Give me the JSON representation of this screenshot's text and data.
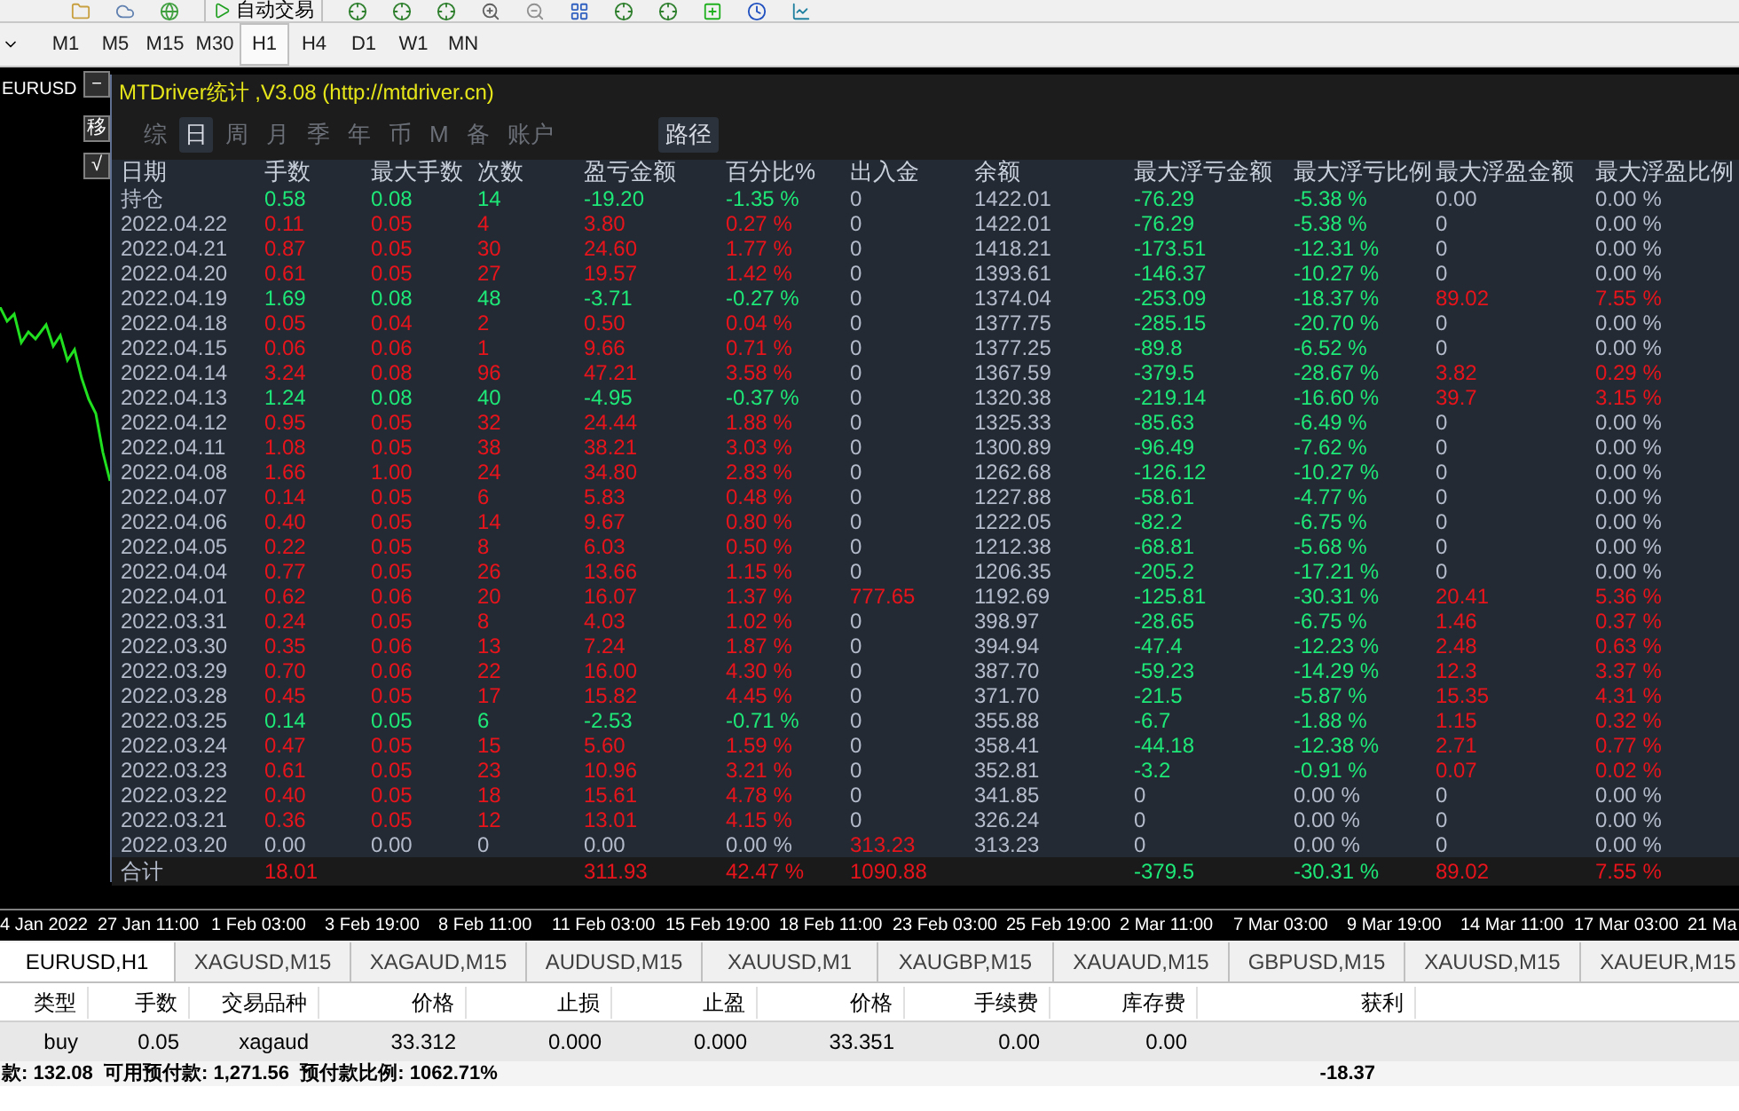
{
  "toolbar": {
    "auto_trading_label": "自动交易"
  },
  "timeframes": [
    {
      "label": "M1",
      "selected": false
    },
    {
      "label": "M5",
      "selected": false
    },
    {
      "label": "M15",
      "selected": false
    },
    {
      "label": "M30",
      "selected": false
    },
    {
      "label": "H1",
      "selected": true
    },
    {
      "label": "H4",
      "selected": false
    },
    {
      "label": "D1",
      "selected": false
    },
    {
      "label": "W1",
      "selected": false
    },
    {
      "label": "MN",
      "selected": false
    }
  ],
  "chart": {
    "symbol_label": "EURUSD",
    "side_buttons": [
      "－",
      "移",
      "√"
    ],
    "time_axis": [
      "4 Jan 2022",
      "27 Jan 11:00",
      "1 Feb 03:00",
      "3 Feb 19:00",
      "8 Feb 11:00",
      "11 Feb 03:00",
      "15 Feb 19:00",
      "18 Feb 11:00",
      "23 Feb 03:00",
      "25 Feb 19:00",
      "2 Mar 11:00",
      "7 Mar 03:00",
      "9 Mar 19:00",
      "14 Mar 11:00",
      "17 Mar 03:00",
      "21 Ma"
    ]
  },
  "stats_panel": {
    "title": "MTDriver统计 ,V3.08 (http://mtdriver.cn)",
    "tabs": [
      {
        "label": "综",
        "selected": false
      },
      {
        "label": "日",
        "selected": true
      },
      {
        "label": "周",
        "selected": false
      },
      {
        "label": "月",
        "selected": false
      },
      {
        "label": "季",
        "selected": false
      },
      {
        "label": "年",
        "selected": false
      },
      {
        "label": "币",
        "selected": false
      },
      {
        "label": "M",
        "selected": false
      },
      {
        "label": "备",
        "selected": false
      },
      {
        "label": "账户",
        "selected": false
      }
    ],
    "path_button": "路径",
    "columns": [
      "日期",
      "手数",
      "最大手数",
      "次数",
      "盈亏金额",
      "百分比%",
      "出入金",
      "余额",
      "最大浮亏金额",
      "最大浮亏比例",
      "最大浮盈金额",
      "最大浮盈比例"
    ],
    "rows": [
      [
        {
          "text": "持仓",
          "color": "#b4bccc"
        },
        {
          "text": "0.58",
          "color": "#1ee878"
        },
        {
          "text": "0.08",
          "color": "#1ee878"
        },
        {
          "text": "14",
          "color": "#1ee878"
        },
        {
          "text": "-19.20",
          "color": "#1ee878"
        },
        {
          "text": "-1.35 %",
          "color": "#1ee878"
        },
        {
          "text": "0",
          "color": "#b4bccc"
        },
        {
          "text": "1422.01",
          "color": "#b4bccc"
        },
        {
          "text": "-76.29",
          "color": "#1ee878"
        },
        {
          "text": "-5.38 %",
          "color": "#1ee878"
        },
        {
          "text": "0.00",
          "color": "#b4bccc"
        },
        {
          "text": "0.00 %",
          "color": "#b4bccc"
        }
      ],
      [
        {
          "text": "2022.04.22",
          "color": "#b4bccc"
        },
        {
          "text": "0.11",
          "color": "#e8141c"
        },
        {
          "text": "0.05",
          "color": "#e8141c"
        },
        {
          "text": "4",
          "color": "#e8141c"
        },
        {
          "text": "3.80",
          "color": "#e8141c"
        },
        {
          "text": "0.27 %",
          "color": "#e8141c"
        },
        {
          "text": "0",
          "color": "#b4bccc"
        },
        {
          "text": "1422.01",
          "color": "#b4bccc"
        },
        {
          "text": "-76.29",
          "color": "#1ee878"
        },
        {
          "text": "-5.38 %",
          "color": "#1ee878"
        },
        {
          "text": "0",
          "color": "#b4bccc"
        },
        {
          "text": "0.00 %",
          "color": "#b4bccc"
        }
      ],
      [
        {
          "text": "2022.04.21",
          "color": "#b4bccc"
        },
        {
          "text": "0.87",
          "color": "#e8141c"
        },
        {
          "text": "0.05",
          "color": "#e8141c"
        },
        {
          "text": "30",
          "color": "#e8141c"
        },
        {
          "text": "24.60",
          "color": "#e8141c"
        },
        {
          "text": "1.77 %",
          "color": "#e8141c"
        },
        {
          "text": "0",
          "color": "#b4bccc"
        },
        {
          "text": "1418.21",
          "color": "#b4bccc"
        },
        {
          "text": "-173.51",
          "color": "#1ee878"
        },
        {
          "text": "-12.31 %",
          "color": "#1ee878"
        },
        {
          "text": "0",
          "color": "#b4bccc"
        },
        {
          "text": "0.00 %",
          "color": "#b4bccc"
        }
      ],
      [
        {
          "text": "2022.04.20",
          "color": "#b4bccc"
        },
        {
          "text": "0.61",
          "color": "#e8141c"
        },
        {
          "text": "0.05",
          "color": "#e8141c"
        },
        {
          "text": "27",
          "color": "#e8141c"
        },
        {
          "text": "19.57",
          "color": "#e8141c"
        },
        {
          "text": "1.42 %",
          "color": "#e8141c"
        },
        {
          "text": "0",
          "color": "#b4bccc"
        },
        {
          "text": "1393.61",
          "color": "#b4bccc"
        },
        {
          "text": "-146.37",
          "color": "#1ee878"
        },
        {
          "text": "-10.27 %",
          "color": "#1ee878"
        },
        {
          "text": "0",
          "color": "#b4bccc"
        },
        {
          "text": "0.00 %",
          "color": "#b4bccc"
        }
      ],
      [
        {
          "text": "2022.04.19",
          "color": "#b4bccc"
        },
        {
          "text": "1.69",
          "color": "#1ee878"
        },
        {
          "text": "0.08",
          "color": "#1ee878"
        },
        {
          "text": "48",
          "color": "#1ee878"
        },
        {
          "text": "-3.71",
          "color": "#1ee878"
        },
        {
          "text": "-0.27 %",
          "color": "#1ee878"
        },
        {
          "text": "0",
          "color": "#b4bccc"
        },
        {
          "text": "1374.04",
          "color": "#b4bccc"
        },
        {
          "text": "-253.09",
          "color": "#1ee878"
        },
        {
          "text": "-18.37 %",
          "color": "#1ee878"
        },
        {
          "text": "89.02",
          "color": "#e8141c"
        },
        {
          "text": "7.55 %",
          "color": "#e8141c"
        }
      ],
      [
        {
          "text": "2022.04.18",
          "color": "#b4bccc"
        },
        {
          "text": "0.05",
          "color": "#e8141c"
        },
        {
          "text": "0.04",
          "color": "#e8141c"
        },
        {
          "text": "2",
          "color": "#e8141c"
        },
        {
          "text": "0.50",
          "color": "#e8141c"
        },
        {
          "text": "0.04 %",
          "color": "#e8141c"
        },
        {
          "text": "0",
          "color": "#b4bccc"
        },
        {
          "text": "1377.75",
          "color": "#b4bccc"
        },
        {
          "text": "-285.15",
          "color": "#1ee878"
        },
        {
          "text": "-20.70 %",
          "color": "#1ee878"
        },
        {
          "text": "0",
          "color": "#b4bccc"
        },
        {
          "text": "0.00 %",
          "color": "#b4bccc"
        }
      ],
      [
        {
          "text": "2022.04.15",
          "color": "#b4bccc"
        },
        {
          "text": "0.06",
          "color": "#e8141c"
        },
        {
          "text": "0.06",
          "color": "#e8141c"
        },
        {
          "text": "1",
          "color": "#e8141c"
        },
        {
          "text": "9.66",
          "color": "#e8141c"
        },
        {
          "text": "0.71 %",
          "color": "#e8141c"
        },
        {
          "text": "0",
          "color": "#b4bccc"
        },
        {
          "text": "1377.25",
          "color": "#b4bccc"
        },
        {
          "text": "-89.8",
          "color": "#1ee878"
        },
        {
          "text": "-6.52 %",
          "color": "#1ee878"
        },
        {
          "text": "0",
          "color": "#b4bccc"
        },
        {
          "text": "0.00 %",
          "color": "#b4bccc"
        }
      ],
      [
        {
          "text": "2022.04.14",
          "color": "#b4bccc"
        },
        {
          "text": "3.24",
          "color": "#e8141c"
        },
        {
          "text": "0.08",
          "color": "#e8141c"
        },
        {
          "text": "96",
          "color": "#e8141c"
        },
        {
          "text": "47.21",
          "color": "#e8141c"
        },
        {
          "text": "3.58 %",
          "color": "#e8141c"
        },
        {
          "text": "0",
          "color": "#b4bccc"
        },
        {
          "text": "1367.59",
          "color": "#b4bccc"
        },
        {
          "text": "-379.5",
          "color": "#1ee878"
        },
        {
          "text": "-28.67 %",
          "color": "#1ee878"
        },
        {
          "text": "3.82",
          "color": "#e8141c"
        },
        {
          "text": "0.29 %",
          "color": "#e8141c"
        }
      ],
      [
        {
          "text": "2022.04.13",
          "color": "#b4bccc"
        },
        {
          "text": "1.24",
          "color": "#1ee878"
        },
        {
          "text": "0.08",
          "color": "#1ee878"
        },
        {
          "text": "40",
          "color": "#1ee878"
        },
        {
          "text": "-4.95",
          "color": "#1ee878"
        },
        {
          "text": "-0.37 %",
          "color": "#1ee878"
        },
        {
          "text": "0",
          "color": "#b4bccc"
        },
        {
          "text": "1320.38",
          "color": "#b4bccc"
        },
        {
          "text": "-219.14",
          "color": "#1ee878"
        },
        {
          "text": "-16.60 %",
          "color": "#1ee878"
        },
        {
          "text": "39.7",
          "color": "#e8141c"
        },
        {
          "text": "3.15 %",
          "color": "#e8141c"
        }
      ],
      [
        {
          "text": "2022.04.12",
          "color": "#b4bccc"
        },
        {
          "text": "0.95",
          "color": "#e8141c"
        },
        {
          "text": "0.05",
          "color": "#e8141c"
        },
        {
          "text": "32",
          "color": "#e8141c"
        },
        {
          "text": "24.44",
          "color": "#e8141c"
        },
        {
          "text": "1.88 %",
          "color": "#e8141c"
        },
        {
          "text": "0",
          "color": "#b4bccc"
        },
        {
          "text": "1325.33",
          "color": "#b4bccc"
        },
        {
          "text": "-85.63",
          "color": "#1ee878"
        },
        {
          "text": "-6.49 %",
          "color": "#1ee878"
        },
        {
          "text": "0",
          "color": "#b4bccc"
        },
        {
          "text": "0.00 %",
          "color": "#b4bccc"
        }
      ],
      [
        {
          "text": "2022.04.11",
          "color": "#b4bccc"
        },
        {
          "text": "1.08",
          "color": "#e8141c"
        },
        {
          "text": "0.05",
          "color": "#e8141c"
        },
        {
          "text": "38",
          "color": "#e8141c"
        },
        {
          "text": "38.21",
          "color": "#e8141c"
        },
        {
          "text": "3.03 %",
          "color": "#e8141c"
        },
        {
          "text": "0",
          "color": "#b4bccc"
        },
        {
          "text": "1300.89",
          "color": "#b4bccc"
        },
        {
          "text": "-96.49",
          "color": "#1ee878"
        },
        {
          "text": "-7.62 %",
          "color": "#1ee878"
        },
        {
          "text": "0",
          "color": "#b4bccc"
        },
        {
          "text": "0.00 %",
          "color": "#b4bccc"
        }
      ],
      [
        {
          "text": "2022.04.08",
          "color": "#b4bccc"
        },
        {
          "text": "1.66",
          "color": "#e8141c"
        },
        {
          "text": "1.00",
          "color": "#e8141c"
        },
        {
          "text": "24",
          "color": "#e8141c"
        },
        {
          "text": "34.80",
          "color": "#e8141c"
        },
        {
          "text": "2.83 %",
          "color": "#e8141c"
        },
        {
          "text": "0",
          "color": "#b4bccc"
        },
        {
          "text": "1262.68",
          "color": "#b4bccc"
        },
        {
          "text": "-126.12",
          "color": "#1ee878"
        },
        {
          "text": "-10.27 %",
          "color": "#1ee878"
        },
        {
          "text": "0",
          "color": "#b4bccc"
        },
        {
          "text": "0.00 %",
          "color": "#b4bccc"
        }
      ],
      [
        {
          "text": "2022.04.07",
          "color": "#b4bccc"
        },
        {
          "text": "0.14",
          "color": "#e8141c"
        },
        {
          "text": "0.05",
          "color": "#e8141c"
        },
        {
          "text": "6",
          "color": "#e8141c"
        },
        {
          "text": "5.83",
          "color": "#e8141c"
        },
        {
          "text": "0.48 %",
          "color": "#e8141c"
        },
        {
          "text": "0",
          "color": "#b4bccc"
        },
        {
          "text": "1227.88",
          "color": "#b4bccc"
        },
        {
          "text": "-58.61",
          "color": "#1ee878"
        },
        {
          "text": "-4.77 %",
          "color": "#1ee878"
        },
        {
          "text": "0",
          "color": "#b4bccc"
        },
        {
          "text": "0.00 %",
          "color": "#b4bccc"
        }
      ],
      [
        {
          "text": "2022.04.06",
          "color": "#b4bccc"
        },
        {
          "text": "0.40",
          "color": "#e8141c"
        },
        {
          "text": "0.05",
          "color": "#e8141c"
        },
        {
          "text": "14",
          "color": "#e8141c"
        },
        {
          "text": "9.67",
          "color": "#e8141c"
        },
        {
          "text": "0.80 %",
          "color": "#e8141c"
        },
        {
          "text": "0",
          "color": "#b4bccc"
        },
        {
          "text": "1222.05",
          "color": "#b4bccc"
        },
        {
          "text": "-82.2",
          "color": "#1ee878"
        },
        {
          "text": "-6.75 %",
          "color": "#1ee878"
        },
        {
          "text": "0",
          "color": "#b4bccc"
        },
        {
          "text": "0.00 %",
          "color": "#b4bccc"
        }
      ],
      [
        {
          "text": "2022.04.05",
          "color": "#b4bccc"
        },
        {
          "text": "0.22",
          "color": "#e8141c"
        },
        {
          "text": "0.05",
          "color": "#e8141c"
        },
        {
          "text": "8",
          "color": "#e8141c"
        },
        {
          "text": "6.03",
          "color": "#e8141c"
        },
        {
          "text": "0.50 %",
          "color": "#e8141c"
        },
        {
          "text": "0",
          "color": "#b4bccc"
        },
        {
          "text": "1212.38",
          "color": "#b4bccc"
        },
        {
          "text": "-68.81",
          "color": "#1ee878"
        },
        {
          "text": "-5.68 %",
          "color": "#1ee878"
        },
        {
          "text": "0",
          "color": "#b4bccc"
        },
        {
          "text": "0.00 %",
          "color": "#b4bccc"
        }
      ],
      [
        {
          "text": "2022.04.04",
          "color": "#b4bccc"
        },
        {
          "text": "0.77",
          "color": "#e8141c"
        },
        {
          "text": "0.05",
          "color": "#e8141c"
        },
        {
          "text": "26",
          "color": "#e8141c"
        },
        {
          "text": "13.66",
          "color": "#e8141c"
        },
        {
          "text": "1.15 %",
          "color": "#e8141c"
        },
        {
          "text": "0",
          "color": "#b4bccc"
        },
        {
          "text": "1206.35",
          "color": "#b4bccc"
        },
        {
          "text": "-205.2",
          "color": "#1ee878"
        },
        {
          "text": "-17.21 %",
          "color": "#1ee878"
        },
        {
          "text": "0",
          "color": "#b4bccc"
        },
        {
          "text": "0.00 %",
          "color": "#b4bccc"
        }
      ],
      [
        {
          "text": "2022.04.01",
          "color": "#b4bccc"
        },
        {
          "text": "0.62",
          "color": "#e8141c"
        },
        {
          "text": "0.06",
          "color": "#e8141c"
        },
        {
          "text": "20",
          "color": "#e8141c"
        },
        {
          "text": "16.07",
          "color": "#e8141c"
        },
        {
          "text": "1.37 %",
          "color": "#e8141c"
        },
        {
          "text": "777.65",
          "color": "#e8141c"
        },
        {
          "text": "1192.69",
          "color": "#b4bccc"
        },
        {
          "text": "-125.81",
          "color": "#1ee878"
        },
        {
          "text": "-30.31 %",
          "color": "#1ee878"
        },
        {
          "text": "20.41",
          "color": "#e8141c"
        },
        {
          "text": "5.36 %",
          "color": "#e8141c"
        }
      ],
      [
        {
          "text": "2022.03.31",
          "color": "#b4bccc"
        },
        {
          "text": "0.24",
          "color": "#e8141c"
        },
        {
          "text": "0.05",
          "color": "#e8141c"
        },
        {
          "text": "8",
          "color": "#e8141c"
        },
        {
          "text": "4.03",
          "color": "#e8141c"
        },
        {
          "text": "1.02 %",
          "color": "#e8141c"
        },
        {
          "text": "0",
          "color": "#b4bccc"
        },
        {
          "text": "398.97",
          "color": "#b4bccc"
        },
        {
          "text": "-28.65",
          "color": "#1ee878"
        },
        {
          "text": "-6.75 %",
          "color": "#1ee878"
        },
        {
          "text": "1.46",
          "color": "#e8141c"
        },
        {
          "text": "0.37 %",
          "color": "#e8141c"
        }
      ],
      [
        {
          "text": "2022.03.30",
          "color": "#b4bccc"
        },
        {
          "text": "0.35",
          "color": "#e8141c"
        },
        {
          "text": "0.06",
          "color": "#e8141c"
        },
        {
          "text": "13",
          "color": "#e8141c"
        },
        {
          "text": "7.24",
          "color": "#e8141c"
        },
        {
          "text": "1.87 %",
          "color": "#e8141c"
        },
        {
          "text": "0",
          "color": "#b4bccc"
        },
        {
          "text": "394.94",
          "color": "#b4bccc"
        },
        {
          "text": "-47.4",
          "color": "#1ee878"
        },
        {
          "text": "-12.23 %",
          "color": "#1ee878"
        },
        {
          "text": "2.48",
          "color": "#e8141c"
        },
        {
          "text": "0.63 %",
          "color": "#e8141c"
        }
      ],
      [
        {
          "text": "2022.03.29",
          "color": "#b4bccc"
        },
        {
          "text": "0.70",
          "color": "#e8141c"
        },
        {
          "text": "0.06",
          "color": "#e8141c"
        },
        {
          "text": "22",
          "color": "#e8141c"
        },
        {
          "text": "16.00",
          "color": "#e8141c"
        },
        {
          "text": "4.30 %",
          "color": "#e8141c"
        },
        {
          "text": "0",
          "color": "#b4bccc"
        },
        {
          "text": "387.70",
          "color": "#b4bccc"
        },
        {
          "text": "-59.23",
          "color": "#1ee878"
        },
        {
          "text": "-14.29 %",
          "color": "#1ee878"
        },
        {
          "text": "12.3",
          "color": "#e8141c"
        },
        {
          "text": "3.37 %",
          "color": "#e8141c"
        }
      ],
      [
        {
          "text": "2022.03.28",
          "color": "#b4bccc"
        },
        {
          "text": "0.45",
          "color": "#e8141c"
        },
        {
          "text": "0.05",
          "color": "#e8141c"
        },
        {
          "text": "17",
          "color": "#e8141c"
        },
        {
          "text": "15.82",
          "color": "#e8141c"
        },
        {
          "text": "4.45 %",
          "color": "#e8141c"
        },
        {
          "text": "0",
          "color": "#b4bccc"
        },
        {
          "text": "371.70",
          "color": "#b4bccc"
        },
        {
          "text": "-21.5",
          "color": "#1ee878"
        },
        {
          "text": "-5.87 %",
          "color": "#1ee878"
        },
        {
          "text": "15.35",
          "color": "#e8141c"
        },
        {
          "text": "4.31 %",
          "color": "#e8141c"
        }
      ],
      [
        {
          "text": "2022.03.25",
          "color": "#b4bccc"
        },
        {
          "text": "0.14",
          "color": "#1ee878"
        },
        {
          "text": "0.05",
          "color": "#1ee878"
        },
        {
          "text": "6",
          "color": "#1ee878"
        },
        {
          "text": "-2.53",
          "color": "#1ee878"
        },
        {
          "text": "-0.71 %",
          "color": "#1ee878"
        },
        {
          "text": "0",
          "color": "#b4bccc"
        },
        {
          "text": "355.88",
          "color": "#b4bccc"
        },
        {
          "text": "-6.7",
          "color": "#1ee878"
        },
        {
          "text": "-1.88 %",
          "color": "#1ee878"
        },
        {
          "text": "1.15",
          "color": "#e8141c"
        },
        {
          "text": "0.32 %",
          "color": "#e8141c"
        }
      ],
      [
        {
          "text": "2022.03.24",
          "color": "#b4bccc"
        },
        {
          "text": "0.47",
          "color": "#e8141c"
        },
        {
          "text": "0.05",
          "color": "#e8141c"
        },
        {
          "text": "15",
          "color": "#e8141c"
        },
        {
          "text": "5.60",
          "color": "#e8141c"
        },
        {
          "text": "1.59 %",
          "color": "#e8141c"
        },
        {
          "text": "0",
          "color": "#b4bccc"
        },
        {
          "text": "358.41",
          "color": "#b4bccc"
        },
        {
          "text": "-44.18",
          "color": "#1ee878"
        },
        {
          "text": "-12.38 %",
          "color": "#1ee878"
        },
        {
          "text": "2.71",
          "color": "#e8141c"
        },
        {
          "text": "0.77 %",
          "color": "#e8141c"
        }
      ],
      [
        {
          "text": "2022.03.23",
          "color": "#b4bccc"
        },
        {
          "text": "0.61",
          "color": "#e8141c"
        },
        {
          "text": "0.05",
          "color": "#e8141c"
        },
        {
          "text": "23",
          "color": "#e8141c"
        },
        {
          "text": "10.96",
          "color": "#e8141c"
        },
        {
          "text": "3.21 %",
          "color": "#e8141c"
        },
        {
          "text": "0",
          "color": "#b4bccc"
        },
        {
          "text": "352.81",
          "color": "#b4bccc"
        },
        {
          "text": "-3.2",
          "color": "#1ee878"
        },
        {
          "text": "-0.91 %",
          "color": "#1ee878"
        },
        {
          "text": "0.07",
          "color": "#e8141c"
        },
        {
          "text": "0.02 %",
          "color": "#e8141c"
        }
      ],
      [
        {
          "text": "2022.03.22",
          "color": "#b4bccc"
        },
        {
          "text": "0.40",
          "color": "#e8141c"
        },
        {
          "text": "0.05",
          "color": "#e8141c"
        },
        {
          "text": "18",
          "color": "#e8141c"
        },
        {
          "text": "15.61",
          "color": "#e8141c"
        },
        {
          "text": "4.78 %",
          "color": "#e8141c"
        },
        {
          "text": "0",
          "color": "#b4bccc"
        },
        {
          "text": "341.85",
          "color": "#b4bccc"
        },
        {
          "text": "0",
          "color": "#b4bccc"
        },
        {
          "text": "0.00 %",
          "color": "#b4bccc"
        },
        {
          "text": "0",
          "color": "#b4bccc"
        },
        {
          "text": "0.00 %",
          "color": "#b4bccc"
        }
      ],
      [
        {
          "text": "2022.03.21",
          "color": "#b4bccc"
        },
        {
          "text": "0.36",
          "color": "#e8141c"
        },
        {
          "text": "0.05",
          "color": "#e8141c"
        },
        {
          "text": "12",
          "color": "#e8141c"
        },
        {
          "text": "13.01",
          "color": "#e8141c"
        },
        {
          "text": "4.15 %",
          "color": "#e8141c"
        },
        {
          "text": "0",
          "color": "#b4bccc"
        },
        {
          "text": "326.24",
          "color": "#b4bccc"
        },
        {
          "text": "0",
          "color": "#b4bccc"
        },
        {
          "text": "0.00 %",
          "color": "#b4bccc"
        },
        {
          "text": "0",
          "color": "#b4bccc"
        },
        {
          "text": "0.00 %",
          "color": "#b4bccc"
        }
      ],
      [
        {
          "text": "2022.03.20",
          "color": "#b4bccc"
        },
        {
          "text": "0.00",
          "color": "#b4bccc"
        },
        {
          "text": "0.00",
          "color": "#b4bccc"
        },
        {
          "text": "0",
          "color": "#b4bccc"
        },
        {
          "text": "0.00",
          "color": "#b4bccc"
        },
        {
          "text": "0.00 %",
          "color": "#b4bccc"
        },
        {
          "text": "313.23",
          "color": "#e8141c"
        },
        {
          "text": "313.23",
          "color": "#b4bccc"
        },
        {
          "text": "0",
          "color": "#b4bccc"
        },
        {
          "text": "0.00 %",
          "color": "#b4bccc"
        },
        {
          "text": "0",
          "color": "#b4bccc"
        },
        {
          "text": "0.00 %",
          "color": "#b4bccc"
        }
      ]
    ],
    "total_row": {
      "label": {
        "text": "合计",
        "color": "#b4bccc"
      },
      "lots": {
        "text": "18.01",
        "color": "#e8141c"
      },
      "profit": {
        "text": "311.93",
        "color": "#e8141c"
      },
      "percent": {
        "text": "42.47 %",
        "color": "#e8141c"
      },
      "deposit": {
        "text": "1090.88",
        "color": "#e8141c"
      },
      "max_float_loss": {
        "text": "-379.5",
        "color": "#1ee878"
      },
      "max_float_loss_pct": {
        "text": "-30.31 %",
        "color": "#1ee878"
      },
      "max_float_profit": {
        "text": "89.02",
        "color": "#e8141c"
      },
      "max_float_profit_pct": {
        "text": "7.55 %",
        "color": "#e8141c"
      }
    }
  },
  "symbol_tabs": [
    {
      "label": "EURUSD,H1",
      "selected": true
    },
    {
      "label": "XAGUSD,M15",
      "selected": false
    },
    {
      "label": "XAGAUD,M15",
      "selected": false
    },
    {
      "label": "AUDUSD,M15",
      "selected": false
    },
    {
      "label": "XAUUSD,M1",
      "selected": false
    },
    {
      "label": "XAUGBP,M15",
      "selected": false
    },
    {
      "label": "XAUAUD,M15",
      "selected": false
    },
    {
      "label": "GBPUSD,M15",
      "selected": false
    },
    {
      "label": "XAUUSD,M15",
      "selected": false
    },
    {
      "label": "XAUEUR,M15",
      "selected": false
    }
  ],
  "trade_table": {
    "columns": [
      "类型",
      "手数",
      "交易品种",
      "价格",
      "止损",
      "止盈",
      "价格",
      "手续费",
      "库存费",
      "获利"
    ],
    "rows": [
      [
        "buy",
        "0.05",
        "xagaud",
        "33.312",
        "0.000",
        "0.000",
        "33.351",
        "0.00",
        "0.00"
      ]
    ],
    "summary": "款: 132.08  可用预付款: 1,271.56  预付款比例: 1062.71%",
    "summary_profit": "-18.37"
  }
}
